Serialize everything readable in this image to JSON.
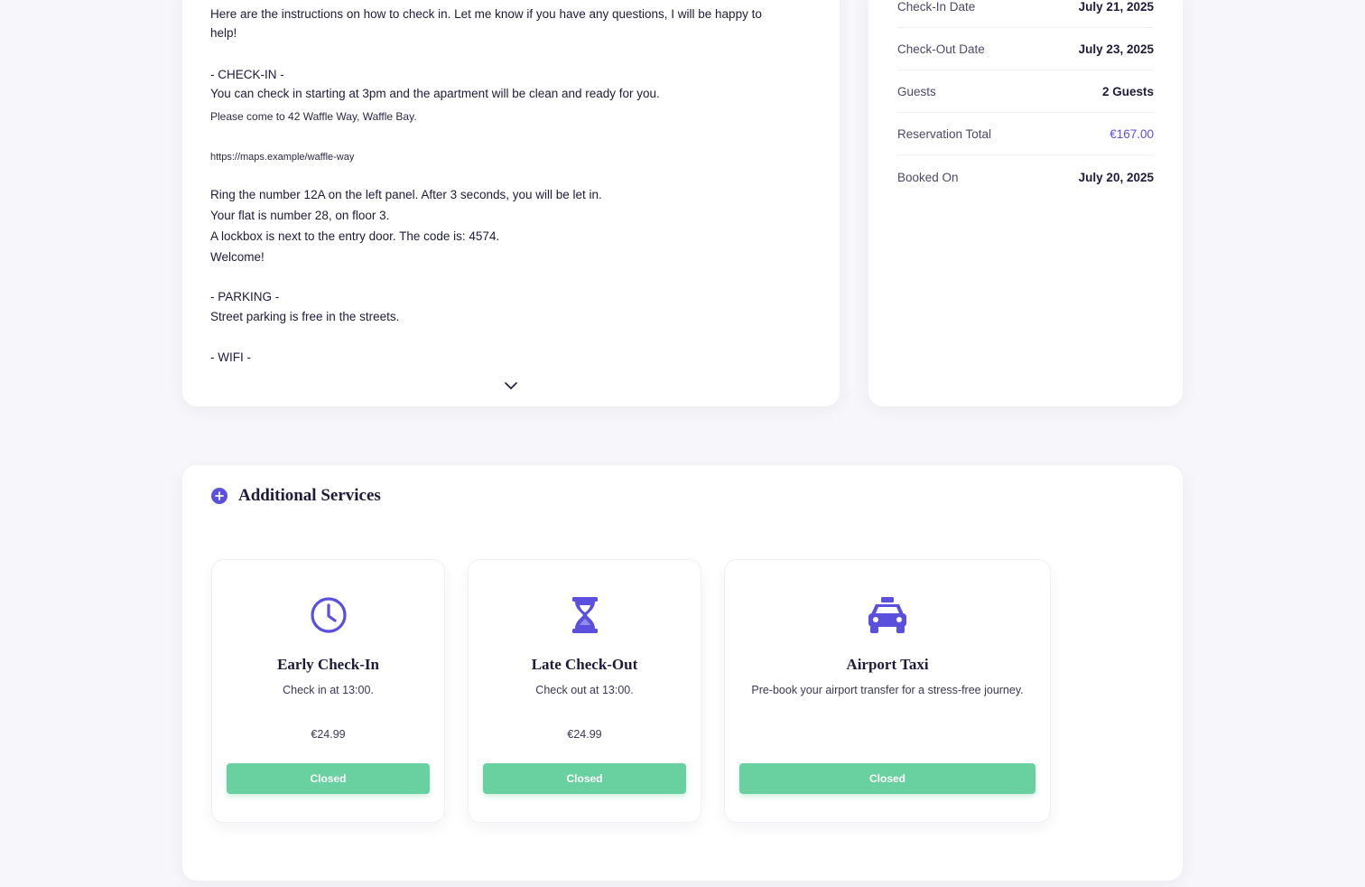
{
  "colors": {
    "accent": "#5b4fdd",
    "button_green": "#69d1a0",
    "text_dark": "#1e1b3a"
  },
  "instructions": {
    "lines": [
      "Here are the instructions on how to check in. Let me know if you have any questions, I will be happy to",
      "help!",
      "- CHECK-IN -",
      "You can check in starting at 3pm and the apartment will be clean and ready for you.",
      "Please come to 42 Waffle Way, Waffle Bay.",
      "https://maps.example/waffle-way",
      "Ring the number 12A on the left panel. After 3 seconds, you will be let in.",
      "Your flat is number 28, on floor 3.",
      "A lockbox is next to the entry door. The code is: 4574.",
      "Welcome!",
      "- PARKING -",
      "Street parking is free in the streets.",
      "- WIFI -"
    ],
    "expand_icon": "chevron-down-icon"
  },
  "details": {
    "rows": [
      {
        "label": "Check-In Date",
        "value": "July 21, 2025"
      },
      {
        "label": "Check-Out Date",
        "value": "July 23, 2025"
      },
      {
        "label": "Guests",
        "value": "2 Guests"
      },
      {
        "label": "Reservation Total",
        "value": "€167.00"
      },
      {
        "label": "Booked On",
        "value": "July 20, 2025"
      }
    ]
  },
  "services": {
    "title": "Additional Services",
    "header_icon": "plus-circle-icon",
    "items": [
      {
        "icon": "clock-icon",
        "name": "Early Check-In",
        "description": "Check in at 13:00.",
        "price": "€24.99",
        "button": "Closed"
      },
      {
        "icon": "hourglass-icon",
        "name": "Late Check-Out",
        "description": "Check out at 13:00.",
        "price": "€24.99",
        "button": "Closed"
      },
      {
        "icon": "taxi-icon",
        "name": "Airport Taxi",
        "description": "Pre-book your airport transfer for a stress-free journey.",
        "price": "",
        "button": "Closed"
      }
    ]
  }
}
